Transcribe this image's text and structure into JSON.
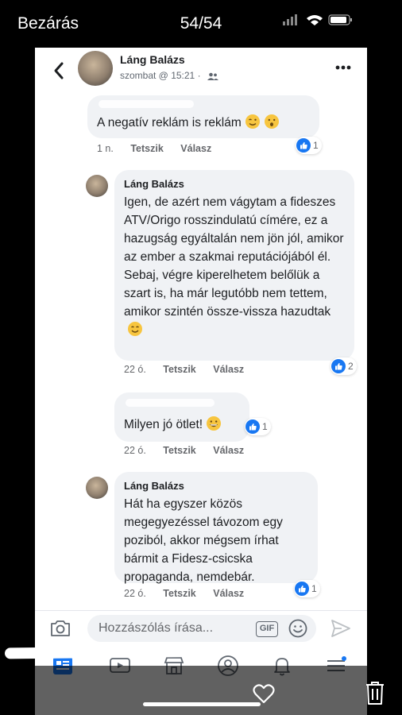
{
  "viewer": {
    "close_label": "Bezárás",
    "counter": "54/54"
  },
  "header": {
    "name": "Láng Balázs",
    "subtitle": "szombat @ 15:21 ·"
  },
  "comments": [
    {
      "author": "",
      "text": "A negatív reklám is reklám",
      "time": "1 n.",
      "like_label": "Tetszik",
      "reply_label": "Válasz",
      "reactions": "1"
    },
    {
      "author": "Láng Balázs",
      "text": "Igen, de azért nem vágytam a fideszes ATV/Origo rosszindulatú címére, ez a hazugság egyáltalán nem jön jól, amikor az ember a szakmai reputációjából él. Sebaj, végre kiperelhetem belőlük a szart is, ha már legutóbb nem tettem, amikor szintén össze-vissza hazudtak",
      "time": "22 ó.",
      "like_label": "Tetszik",
      "reply_label": "Válasz",
      "reactions": "2"
    },
    {
      "author": "",
      "text": "Milyen jó ötlet!",
      "time": "22 ó.",
      "like_label": "Tetszik",
      "reply_label": "Válasz",
      "reactions": "1"
    },
    {
      "author": "Láng Balázs",
      "text": "Hát ha egyszer közös megegyezéssel távozom egy poziból, akkor mégsem írhat bármit a Fidesz-csicska propaganda, nemdebár.",
      "time": "22 ó.",
      "like_label": "Tetszik",
      "reply_label": "Válasz",
      "reactions": "1"
    }
  ],
  "composer": {
    "placeholder": "Hozzászólás írása...",
    "gif_label": "GIF"
  },
  "colors": {
    "accent": "#1877f2",
    "bubble": "#f0f2f5",
    "meta": "#65676b"
  }
}
